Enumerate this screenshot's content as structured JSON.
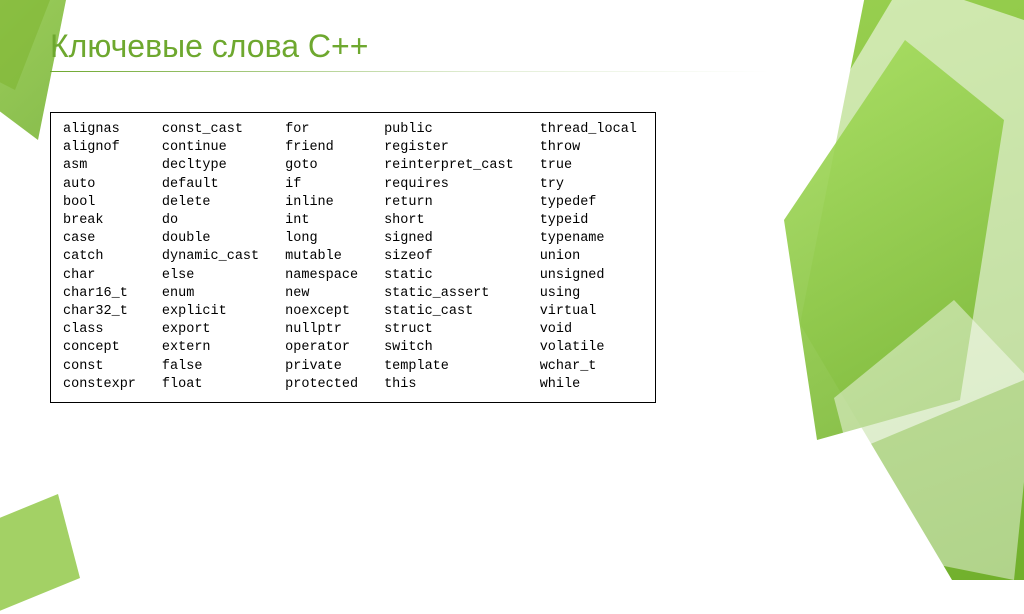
{
  "title": "Ключевые слова С++",
  "columns": [
    [
      "alignas",
      "alignof",
      "asm",
      "auto",
      "bool",
      "break",
      "case",
      "catch",
      "char",
      "char16_t",
      "char32_t",
      "class",
      "concept",
      "const",
      "constexpr"
    ],
    [
      "const_cast",
      "continue",
      "decltype",
      "default",
      "delete",
      "do",
      "double",
      "dynamic_cast",
      "else",
      "enum",
      "explicit",
      "export",
      "extern",
      "false",
      "float"
    ],
    [
      "for",
      "friend",
      "goto",
      "if",
      "inline",
      "int",
      "long",
      "mutable",
      "namespace",
      "new",
      "noexcept",
      "nullptr",
      "operator",
      "private",
      "protected"
    ],
    [
      "public",
      "register",
      "reinterpret_cast",
      "requires",
      "return",
      "short",
      "signed",
      "sizeof",
      "static",
      "static_assert",
      "static_cast",
      "struct",
      "switch",
      "template",
      "this"
    ],
    [
      "thread_local",
      "throw",
      "true",
      "try",
      "typedef",
      "typeid",
      "typename",
      "union",
      "unsigned",
      "using",
      "virtual",
      "void",
      "volatile",
      "wchar_t",
      "while"
    ]
  ]
}
